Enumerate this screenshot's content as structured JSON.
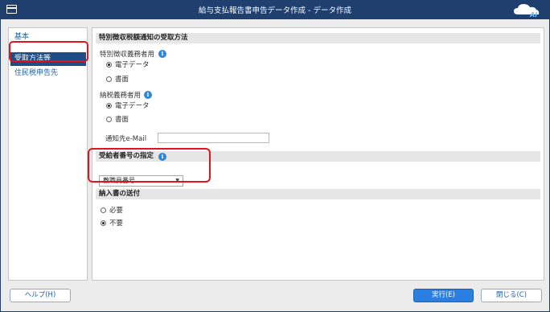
{
  "window": {
    "title": "給与支払報告書申告データ作成 - データ作成",
    "logo_text": "AI"
  },
  "sidebar": {
    "items": [
      {
        "label": "基本"
      },
      {
        "label": "受取方法等"
      },
      {
        "label": "住民税申告先"
      }
    ]
  },
  "sections": {
    "notice": {
      "header": "特別徴収税額通知の受取方法",
      "special_group_label": "特別徴収義務者用",
      "special_options": [
        "電子データ",
        "書面"
      ],
      "special_selected": "電子データ",
      "taxpayer_group_label": "納税義務者用",
      "taxpayer_options": [
        "電子データ",
        "書面"
      ],
      "taxpayer_selected": "電子データ",
      "email_label": "通知先e-Mail",
      "email_value": ""
    },
    "recipient_number": {
      "header": "受給者番号の指定",
      "select_value": "教職員番号"
    },
    "payment_slip": {
      "header": "納入書の送付",
      "options": [
        "必要",
        "不要"
      ],
      "selected": "不要"
    }
  },
  "footer": {
    "help_label": "ヘルプ(H)",
    "run_label": "実行(E)",
    "close_label": "閉じる(C)"
  },
  "icons": {
    "info": "i",
    "dropdown_arrow": "▼"
  },
  "colors": {
    "titlebar": "#1f3f6e",
    "sidebar_active": "#1f4e86",
    "primary_button": "#2b7fe0",
    "highlight": "#e0141c",
    "info_icon": "#2f86d6"
  }
}
